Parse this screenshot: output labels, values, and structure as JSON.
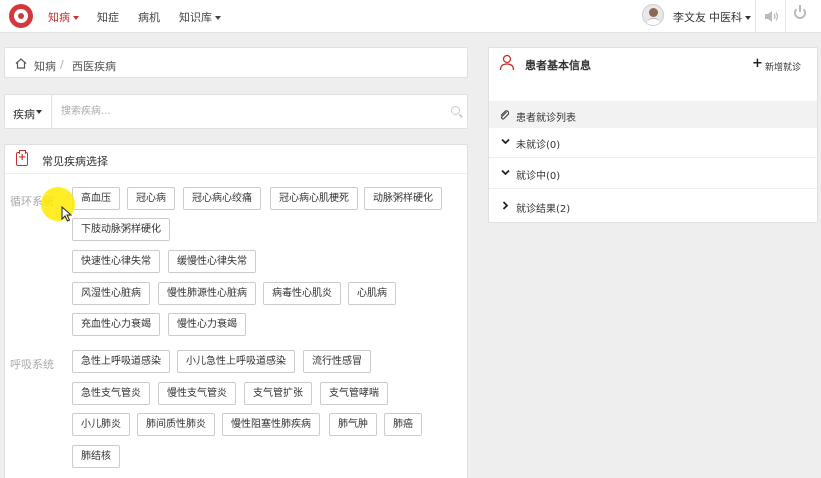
{
  "nav": {
    "items": [
      "知病",
      "知症",
      "病机",
      "知识库"
    ],
    "active_index": 0,
    "user_name": "李文友",
    "department": "中医科"
  },
  "breadcrumb": [
    "知病",
    "/",
    "西医疾病"
  ],
  "search": {
    "category": "疾病",
    "placeholder": "搜索疾病..."
  },
  "disease_panel": {
    "title": "常见疾病选择",
    "categories": [
      {
        "name": "循环系统",
        "tags": [
          "高血压",
          "冠心病",
          "冠心病心绞痛",
          "冠心病心肌梗死",
          "动脉粥样硬化",
          "下肢动脉粥样硬化",
          "快速性心律失常",
          "缓慢性心律失常",
          "风湿性心脏病",
          "慢性肺源性心脏病",
          "病毒性心肌炎",
          "心肌病",
          "充血性心力衰竭",
          "慢性心力衰竭"
        ]
      },
      {
        "name": "呼吸系统",
        "tags": [
          "急性上呼吸道感染",
          "小儿急性上呼吸道感染",
          "流行性感冒",
          "急性支气管炎",
          "慢性支气管炎",
          "支气管扩张",
          "支气管哮喘",
          "小儿肺炎",
          "肺间质性肺炎",
          "慢性阻塞性肺疾病",
          "肺气肿",
          "肺癌",
          "肺结核"
        ]
      }
    ]
  },
  "patient_panel": {
    "title": "患者基本信息",
    "new_visit_label": "新增就诊",
    "list_title": "患者就诊列表",
    "statuses": [
      "未就诊(0)",
      "就诊中(0)",
      "就诊结果(2)"
    ]
  },
  "colors": {
    "accent": "#c9302c",
    "cursor_highlight": "#ffeb00"
  }
}
